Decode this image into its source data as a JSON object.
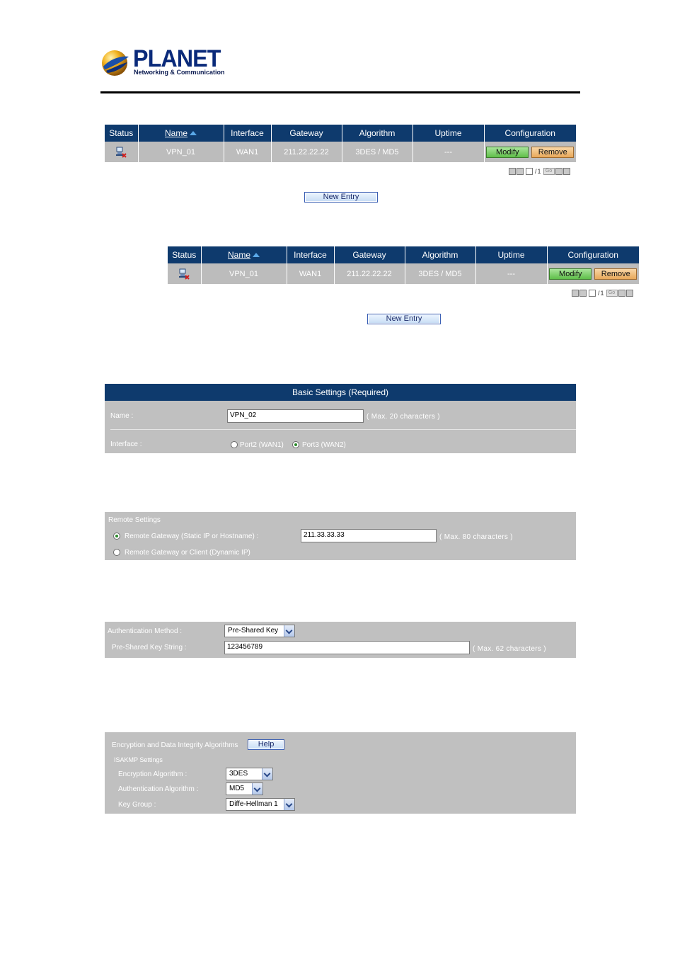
{
  "logo": {
    "word": "PLANET",
    "tagline": "Networking & Communication"
  },
  "table1": {
    "headers": {
      "status": "Status",
      "name": "Name",
      "interface": "Interface",
      "gateway": "Gateway",
      "algorithm": "Algorithm",
      "uptime": "Uptime",
      "configuration": "Configuration"
    },
    "row": {
      "name": "VPN_01",
      "interface": "WAN1",
      "gateway": "211.22.22.22",
      "algorithm": "3DES / MD5",
      "uptime": "---",
      "modify": "Modify",
      "remove": "Remove"
    },
    "pager": {
      "page": "1",
      "sep": "/",
      "total": "1",
      "go": "Go"
    },
    "new_entry": "New Entry"
  },
  "table2": {
    "headers": {
      "status": "Status",
      "name": "Name",
      "interface": "Interface",
      "gateway": "Gateway",
      "algorithm": "Algorithm",
      "uptime": "Uptime",
      "configuration": "Configuration"
    },
    "row": {
      "name": "VPN_01",
      "interface": "WAN1",
      "gateway": "211.22.22.22",
      "algorithm": "3DES / MD5",
      "uptime": "---",
      "modify": "Modify",
      "remove": "Remove"
    },
    "pager": {
      "page": "1",
      "sep": "/",
      "total": "1",
      "go": "Go"
    },
    "new_entry": "New Entry"
  },
  "basic": {
    "title": "Basic Settings (Required)",
    "name_label": "Name :",
    "name_value": "VPN_02",
    "name_hint": "( Max. 20 characters )",
    "interface_label": "Interface :",
    "port2": "Port2 (WAN1)",
    "port3": "Port3 (WAN2)"
  },
  "remote": {
    "title": "Remote Settings",
    "opt_static": "Remote Gateway (Static IP or Hostname) :",
    "gateway_value": "211.33.33.33",
    "gateway_hint": "( Max. 80 characters )",
    "opt_dynamic": "Remote Gateway or Client (Dynamic IP)"
  },
  "auth": {
    "method_label": "Authentication Method :",
    "method_value": "Pre-Shared Key",
    "key_label": "Pre-Shared Key String :",
    "key_value": "123456789",
    "key_hint": "( Max. 62 characters )"
  },
  "encryption": {
    "title": "Encryption and Data Integrity Algorithms",
    "help": "Help",
    "isakmp": "ISAKMP Settings",
    "enc_label": "Encryption Algorithm :",
    "enc_value": "3DES",
    "auth_label": "Authentication Algorithm :",
    "auth_value": "MD5",
    "keygroup_label": "Key Group :",
    "keygroup_value": "Diffe-Hellman 1"
  },
  "colors": {
    "header_blue": "#0e3a6d",
    "panel_gray": "#c0c0c0",
    "modify_green": "#5fbf4a",
    "remove_orange": "#e8a85a"
  }
}
